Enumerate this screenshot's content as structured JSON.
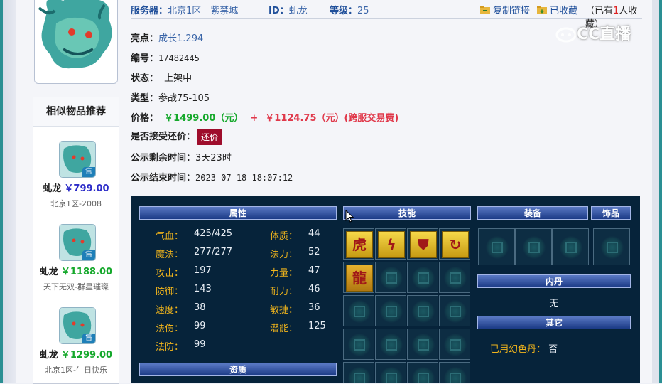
{
  "header": {
    "server_label": "服务器：",
    "server_value": "北京1区—紫禁城",
    "id_label": "ID：",
    "id_value": "虬龙",
    "level_label": "等级：",
    "level_value": "25",
    "copy_link": "复制链接",
    "favorited": "已收藏",
    "fav_count_prefix": "（已有",
    "fav_count": "1",
    "fav_count_suffix": "人收藏）"
  },
  "info": {
    "highlight_label": "亮点：",
    "highlight_value": "成长1.294",
    "number_label": "编号：",
    "number_value": "17482445",
    "status_label": "状态：",
    "status_value": "上架中",
    "type_label": "类型：",
    "type_value": "参战75-105",
    "price_label": "价格：",
    "price_value": "￥1499.00（元）",
    "price_plus": "+",
    "fee_value": "￥1124.75（元）(跨服交易费)",
    "counter_label": "是否接受还价：",
    "counter_button": "还价",
    "remaining_label": "公示剩余时间：",
    "remaining_value": "3天23时",
    "end_label": "公示结束时间：",
    "end_value": "2023-07-18 18:07:12"
  },
  "similar": {
    "title": "相似物品推荐",
    "sale_badge": "售",
    "items": [
      {
        "name": "虬龙",
        "price": "￥799.00",
        "server": "北京1区-2008",
        "price_color": "#2c2cc8"
      },
      {
        "name": "虬龙",
        "price": "￥1188.00",
        "server": "天下无双-群星璀璨",
        "price_color": "#15a82b"
      },
      {
        "name": "虬龙",
        "price": "￥1299.00",
        "server": "北京1区-生日快乐",
        "price_color": "#15a82b"
      }
    ]
  },
  "panel": {
    "attr_title": "属性",
    "skill_title": "技能",
    "equip_title": "装备",
    "accessory_title": "饰品",
    "neidan_title": "内丹",
    "neidan_value": "无",
    "other_title": "其它",
    "aptitude_title": "资质",
    "other_label": "已用幻色丹：",
    "other_value": "否",
    "attrs_left": [
      {
        "k": "气血：",
        "v": "425/425"
      },
      {
        "k": "魔法：",
        "v": "277/277"
      },
      {
        "k": "攻击：",
        "v": "197"
      },
      {
        "k": "防御：",
        "v": "143"
      },
      {
        "k": "速度：",
        "v": "38"
      },
      {
        "k": "法伤：",
        "v": "99"
      },
      {
        "k": "法防：",
        "v": "99"
      }
    ],
    "attrs_right": [
      {
        "k": "体质：",
        "v": "44"
      },
      {
        "k": "法力：",
        "v": "52"
      },
      {
        "k": "力量：",
        "v": "47"
      },
      {
        "k": "耐力：",
        "v": "46"
      },
      {
        "k": "敏捷：",
        "v": "36"
      },
      {
        "k": "潜能：",
        "v": "125"
      }
    ],
    "skill_icons": [
      "tiger-skill-icon",
      "thunder-skill-icon",
      "shield-skill-icon",
      "loop-skill-icon",
      "dragon-skill-icon"
    ]
  },
  "watermark": "CC直播"
}
